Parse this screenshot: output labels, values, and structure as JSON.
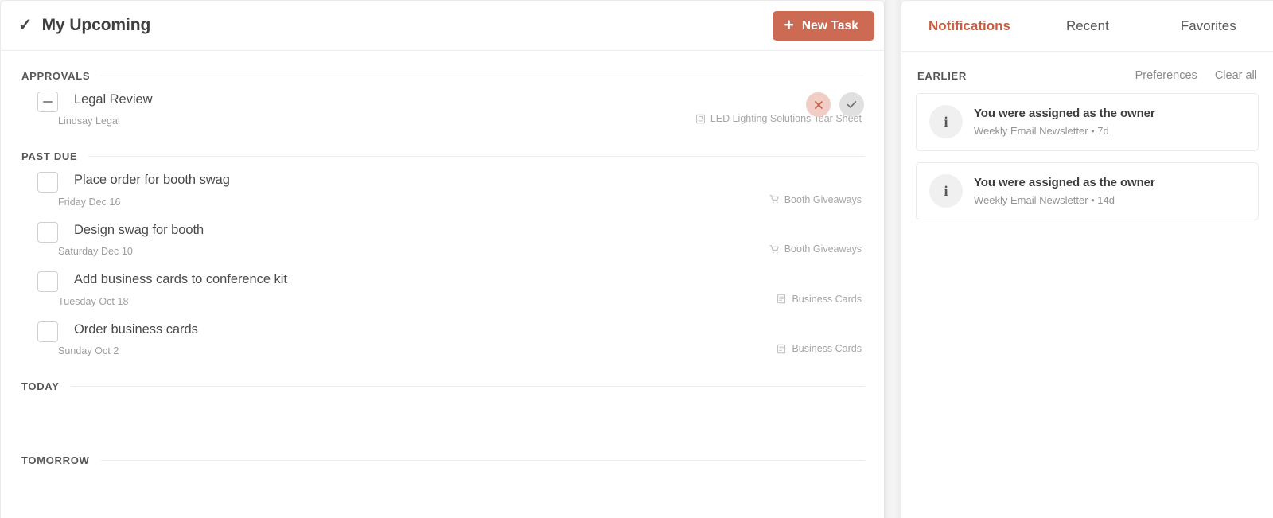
{
  "left": {
    "header": {
      "title": "My Upcoming",
      "check_icon": "check-icon",
      "new_task_label": "New Task",
      "new_task_plus": "+",
      "accent_color": "#cc6a53"
    },
    "sections": [
      {
        "label": "APPROVALS",
        "tasks": [
          {
            "name": "Legal Review",
            "meta": "Lindsay Legal",
            "project": "LED Lighting Solutions Tear Sheet",
            "project_icon": "tear-sheet-icon",
            "checkbox_state": "indeterminate",
            "has_approval_actions": true,
            "reject_label": "✕",
            "approve_label": "✓"
          }
        ]
      },
      {
        "label": "PAST DUE",
        "tasks": [
          {
            "name": "Place order for booth swag",
            "meta": "Friday Dec 16",
            "project": "Booth Giveaways",
            "project_icon": "cart-icon",
            "checkbox_state": "empty",
            "has_approval_actions": false
          },
          {
            "name": "Design swag for booth",
            "meta": "Saturday Dec 10",
            "project": "Booth Giveaways",
            "project_icon": "cart-icon",
            "checkbox_state": "empty",
            "has_approval_actions": false
          },
          {
            "name": "Add business cards to conference kit",
            "meta": "Tuesday Oct 18",
            "project": "Business Cards",
            "project_icon": "note-icon",
            "checkbox_state": "empty",
            "has_approval_actions": false
          },
          {
            "name": "Order business cards",
            "meta": "Sunday Oct 2",
            "project": "Business Cards",
            "project_icon": "note-icon",
            "checkbox_state": "empty",
            "has_approval_actions": false
          }
        ]
      },
      {
        "label": "TODAY",
        "tasks": []
      },
      {
        "label": "TOMORROW",
        "tasks": []
      }
    ]
  },
  "right": {
    "tabs": [
      {
        "label": "Notifications",
        "active": true
      },
      {
        "label": "Recent",
        "active": false
      },
      {
        "label": "Favorites",
        "active": false
      }
    ],
    "active_tab_color": "#cc5c3f",
    "group": {
      "label": "EARLIER",
      "actions": [
        {
          "label": "Preferences"
        },
        {
          "label": "Clear all"
        }
      ]
    },
    "notifications": [
      {
        "icon": "info-icon",
        "icon_glyph": "i",
        "title": "You were assigned as the owner",
        "subtitle": "Weekly Email Newsletter • 7d"
      },
      {
        "icon": "info-icon",
        "icon_glyph": "i",
        "title": "You were assigned as the owner",
        "subtitle": "Weekly Email Newsletter • 14d"
      }
    ]
  }
}
